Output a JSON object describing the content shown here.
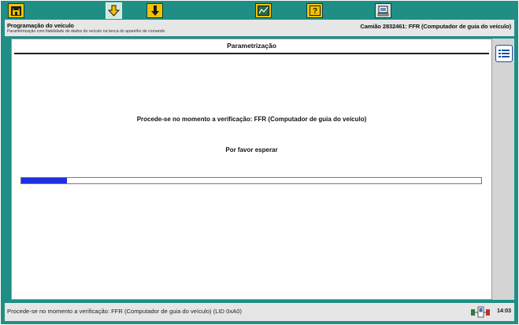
{
  "toolbar": {
    "buttons": [
      {
        "name": "home",
        "icon": "home-icon"
      },
      {
        "name": "download",
        "icon": "download-arrow-icon",
        "active": true
      },
      {
        "name": "info",
        "icon": "info-icon"
      },
      {
        "name": "graph",
        "icon": "graph-icon"
      },
      {
        "name": "help",
        "icon": "help-icon"
      },
      {
        "name": "computer",
        "icon": "computer-icon"
      }
    ],
    "help_label": "?"
  },
  "header": {
    "title": "Programação do veículo",
    "subtitle": "Parametrização com fiabilidade de dados do veículo na tenca do aparelho de comando",
    "right": "Camião 2832461: FFR (Computador de guia do veículo)"
  },
  "panel": {
    "title": "Parametrização",
    "message": "Procede-se no momento a verificação: FFR (Computador de guia do veículo)",
    "wait": "Por favor esperar",
    "progress_fraction": 0.1
  },
  "status": {
    "text": "Procede-se no momento a verificação: FFR (Computador de guia do veículo) (LID 0xA0)",
    "time": "14:03"
  },
  "colors": {
    "frame": "#1f8f86",
    "toolbar_button": "#f2c200",
    "progress_fill": "#1f2fe0"
  }
}
